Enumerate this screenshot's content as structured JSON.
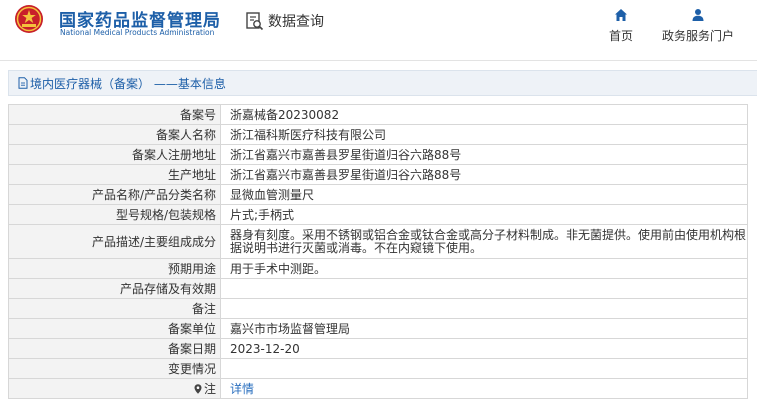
{
  "header": {
    "site_name_cn": "国家药品监督管理局",
    "site_name_en": "National Medical Products Administration",
    "data_query_label": "数据查询",
    "nav": [
      {
        "label": "首页",
        "icon": "home-icon"
      },
      {
        "label": "政务服务门户",
        "icon": "user-icon"
      }
    ],
    "accent_color": "#1d5fa8",
    "emblem_color": "#c8202a"
  },
  "breadcrumb": {
    "text": "境内医疗器械（备案） ——基本信息",
    "icon": "document-icon"
  },
  "detail": {
    "rows": [
      {
        "key": "备案号",
        "value": "浙嘉械备20230082"
      },
      {
        "key": "备案人名称",
        "value": "浙江福科斯医疗科技有限公司"
      },
      {
        "key": "备案人注册地址",
        "value": "浙江省嘉兴市嘉善县罗星街道归谷六路88号"
      },
      {
        "key": "生产地址",
        "value": "浙江省嘉兴市嘉善县罗星街道归谷六路88号"
      },
      {
        "key": "产品名称/产品分类名称",
        "value": "显微血管测量尺"
      },
      {
        "key": "型号规格/包装规格",
        "value": "片式;手柄式"
      },
      {
        "key": "产品描述/主要组成成分",
        "value": "器身有刻度。采用不锈钢或铝合金或钛合金或高分子材料制成。非无菌提供。使用前由使用机构根据说明书进行灭菌或消毒。不在内窥镜下使用。"
      },
      {
        "key": "预期用途",
        "value": "用于手术中测距。"
      },
      {
        "key": "产品存储及有效期",
        "value": ""
      },
      {
        "key": "备注",
        "value": ""
      },
      {
        "key": "备案单位",
        "value": "嘉兴市市场监督管理局"
      },
      {
        "key": "备案日期",
        "value": "2023-12-20"
      },
      {
        "key": "变更情况",
        "value": ""
      },
      {
        "key": "注",
        "value": "详情",
        "icon": "location-pin-icon"
      }
    ]
  }
}
